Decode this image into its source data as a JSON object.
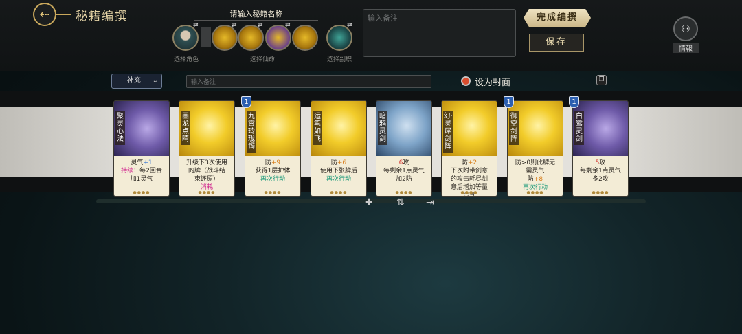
{
  "header": {
    "back_icon": "arrow-back-icon",
    "title": "秘籍编撰"
  },
  "book": {
    "name_placeholder": "请输入秘籍名称",
    "slot_labels": {
      "character": "选择角色",
      "destiny": "选择仙命",
      "career": "选择副职"
    }
  },
  "note_top_placeholder": "输入备注",
  "actions": {
    "finish": "完成编撰",
    "save": "保存"
  },
  "intel": {
    "icon": "intel-icon",
    "label": "情報"
  },
  "toolbar": {
    "supplement_value": "补充",
    "note_placeholder": "输入备注",
    "cover_label": "设为封面",
    "cover_color": "#d94d2e"
  },
  "cards": [
    {
      "name": "聚灵心法",
      "level": "",
      "desc": [
        {
          "t": "灵气",
          "c": "",
          "v": "+1",
          "vc": "hl-blue"
        },
        {
          "t": "持续：",
          "c": "hl-pink",
          "v": "每2回合",
          "vc": ""
        },
        {
          "t": "加1灵气",
          "c": "",
          "v": "",
          "vc": ""
        }
      ],
      "tone": "purple"
    },
    {
      "name": "画龙点睛",
      "level": "",
      "desc": [
        {
          "t": "升级下3次使用",
          "c": "",
          "v": "",
          "vc": ""
        },
        {
          "t": "的牌（战斗结",
          "c": "",
          "v": "",
          "vc": ""
        },
        {
          "t": "束还原）",
          "c": "",
          "v": "",
          "vc": ""
        },
        {
          "t": "消耗",
          "c": "hl-pink",
          "v": "",
          "vc": ""
        }
      ],
      "tone": "yellow"
    },
    {
      "name": "九霄玲珑镯",
      "level": "1",
      "desc": [
        {
          "t": "防",
          "c": "",
          "v": "+9",
          "vc": "hl-orange"
        },
        {
          "t": "获得1层护体",
          "c": "",
          "v": "",
          "vc": ""
        },
        {
          "t": "再次行动",
          "c": "hl-green",
          "v": "",
          "vc": ""
        }
      ],
      "tone": "yellow"
    },
    {
      "name": "运笔如飞",
      "level": "",
      "desc": [
        {
          "t": "防",
          "c": "",
          "v": "+6",
          "vc": "hl-orange"
        },
        {
          "t": "使用下张牌后",
          "c": "",
          "v": "",
          "vc": ""
        },
        {
          "t": "再次行动",
          "c": "hl-green",
          "v": "",
          "vc": ""
        }
      ],
      "tone": "yellow"
    },
    {
      "name": "暗鸦灵剑",
      "level": "",
      "desc": [
        {
          "t": "6",
          "c": "hl-red",
          "v": "攻",
          "vc": ""
        },
        {
          "t": "每剩余1点灵气",
          "c": "",
          "v": "",
          "vc": ""
        },
        {
          "t": "加2防",
          "c": "",
          "v": "",
          "vc": ""
        }
      ],
      "tone": "blue"
    },
    {
      "name": "幻·灵犀剑阵",
      "level": "",
      "desc": [
        {
          "t": "防",
          "c": "",
          "v": "+2",
          "vc": "hl-orange"
        },
        {
          "t": "下次附带剑意",
          "c": "",
          "v": "",
          "vc": ""
        },
        {
          "t": "的攻击耗尽剑",
          "c": "",
          "v": "",
          "vc": ""
        },
        {
          "t": "意后增加等量",
          "c": "",
          "v": "",
          "vc": ""
        },
        {
          "t": "灵气",
          "c": "",
          "v": "",
          "vc": ""
        }
      ],
      "tone": "yellow"
    },
    {
      "name": "御空剑阵",
      "level": "1",
      "desc": [
        {
          "t": "防>0则此牌无",
          "c": "",
          "v": "",
          "vc": ""
        },
        {
          "t": "需灵气",
          "c": "",
          "v": "",
          "vc": ""
        },
        {
          "t": "防",
          "c": "",
          "v": "+8",
          "vc": "hl-orange"
        },
        {
          "t": "再次行动",
          "c": "hl-green",
          "v": "",
          "vc": ""
        }
      ],
      "tone": "yellow"
    },
    {
      "name": "白鹭灵剑",
      "level": "1",
      "desc": [
        {
          "t": "5",
          "c": "hl-red",
          "v": "攻",
          "vc": ""
        },
        {
          "t": "每剩余1点灵气",
          "c": "",
          "v": "",
          "vc": ""
        },
        {
          "t": "多2攻",
          "c": "",
          "v": "",
          "vc": ""
        }
      ],
      "tone": "purple"
    }
  ],
  "bottom_icons": [
    "add-icon",
    "sort-icon",
    "export-icon"
  ]
}
